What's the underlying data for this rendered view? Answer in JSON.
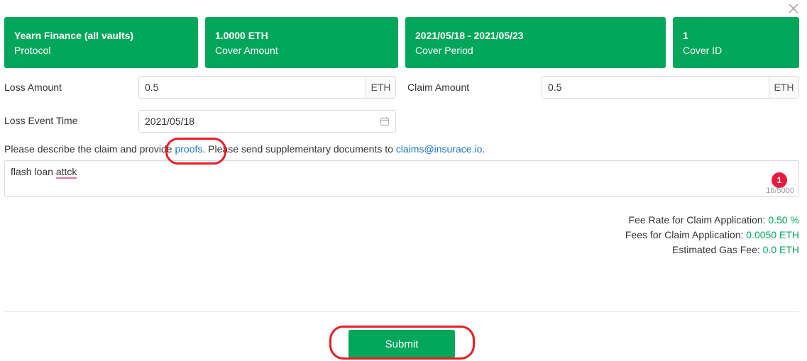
{
  "cards": [
    {
      "value": "Yearn Finance (all vaults)",
      "label": "Protocol"
    },
    {
      "value": "1.0000 ETH",
      "label": "Cover Amount"
    },
    {
      "value": "2021/05/18 - 2021/05/23",
      "label": "Cover Period"
    },
    {
      "value": "1",
      "label": "Cover ID"
    }
  ],
  "loss_amount": {
    "label": "Loss Amount",
    "value": "0.5",
    "unit": "ETH"
  },
  "claim_amount": {
    "label": "Claim Amount",
    "value": "0.5",
    "unit": "ETH"
  },
  "loss_event_time": {
    "label": "Loss Event Time",
    "value": "2021/05/18"
  },
  "description": {
    "prefix": "Please describe the claim and provide ",
    "proofs_link": "proofs",
    "middle": ". Please send supplementary documents to ",
    "email_link": "claims@insurace.io",
    "suffix": "."
  },
  "textarea": {
    "text_start": "flash loan ",
    "text_typo": "attck",
    "counter": "16/5000",
    "badge": "1"
  },
  "fees": {
    "rate_label": "Fee Rate for Claim Application: ",
    "rate_value": "0.50 %",
    "fee_label": "Fees for Claim Application: ",
    "fee_value": "0.0050 ETH",
    "gas_label": "Estimated Gas Fee: ",
    "gas_value": "0.0 ETH"
  },
  "submit_label": "Submit",
  "colors": {
    "accent": "#00a65a",
    "link": "#1a73c8",
    "highlight": "#e81c24",
    "badge": "#e8193a"
  },
  "icons": {
    "close": "close-icon",
    "calendar": "calendar-icon"
  }
}
